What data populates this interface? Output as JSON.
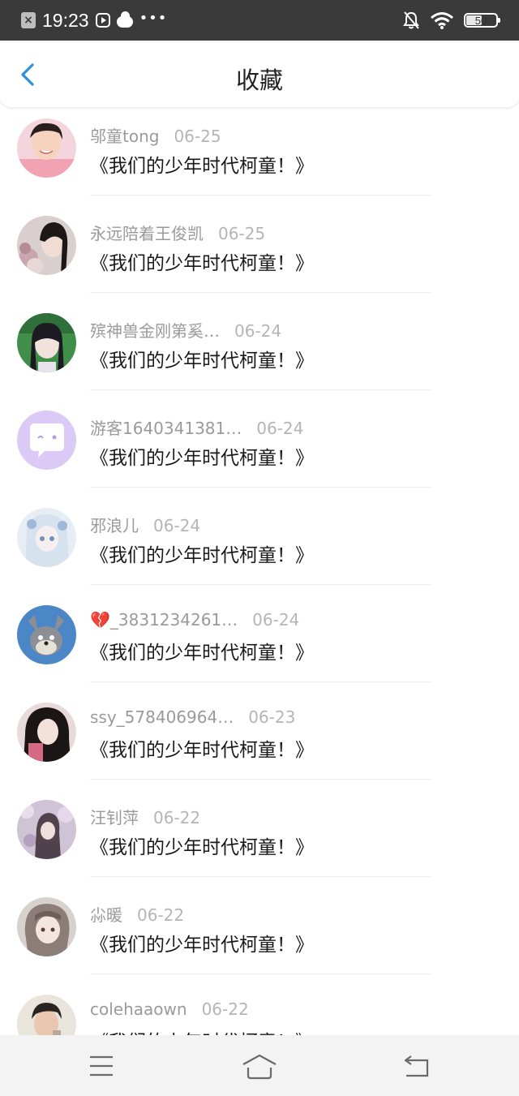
{
  "status_bar": {
    "time": "19:23",
    "battery": "50",
    "icons": [
      "close-notification-icon",
      "video-app-icon",
      "cloud-icon",
      "more-dots-icon",
      "mute-bell-icon",
      "wifi-icon",
      "battery-icon"
    ]
  },
  "header": {
    "title": "收藏",
    "back_icon": "chevron-left-icon",
    "accent_color": "#2f8ee0"
  },
  "favorites": [
    {
      "user": "邬童tong",
      "date": "06-25",
      "title": "《我们的少年时代柯童！》",
      "avatar": "boy-smiling-photo"
    },
    {
      "user": "永远陪着王俊凯",
      "date": "06-25",
      "title": "《我们的少年时代柯童！》",
      "avatar": "girl-flowers-photo"
    },
    {
      "user": "殡神兽金刚第奚…",
      "date": "06-24",
      "title": "《我们的少年时代柯童！》",
      "avatar": "girl-green-photo"
    },
    {
      "user": "游客1640341381…",
      "date": "06-24",
      "title": "《我们的少年时代柯童！》",
      "avatar": "default-chat-bubble-avatar"
    },
    {
      "user": "邪浪儿",
      "date": "06-24",
      "title": "《我们的少年时代柯童！》",
      "avatar": "anime-girl-blue-photo"
    },
    {
      "user": "💔_3831234261…",
      "date": "06-24",
      "title": "《我们的少年时代柯童！》",
      "avatar": "cartoon-cat-photo"
    },
    {
      "user": "ssy_578406964…",
      "date": "06-23",
      "title": "《我们的少年时代柯童！》",
      "avatar": "girl-dark-hair-photo"
    },
    {
      "user": "汪钊萍",
      "date": "06-22",
      "title": "《我们的少年时代柯童！》",
      "avatar": "blossom-photo"
    },
    {
      "user": "尛暖",
      "date": "06-22",
      "title": "《我们的少年时代柯童！》",
      "avatar": "anime-girl-gray-photo"
    },
    {
      "user": "colehaaown",
      "date": "06-22",
      "title": "《我们的少年时代柯童！》",
      "avatar": "boy-selfie-photo"
    }
  ],
  "nav_bar": {
    "icons": [
      "menu-icon",
      "home-icon",
      "back-icon"
    ]
  }
}
